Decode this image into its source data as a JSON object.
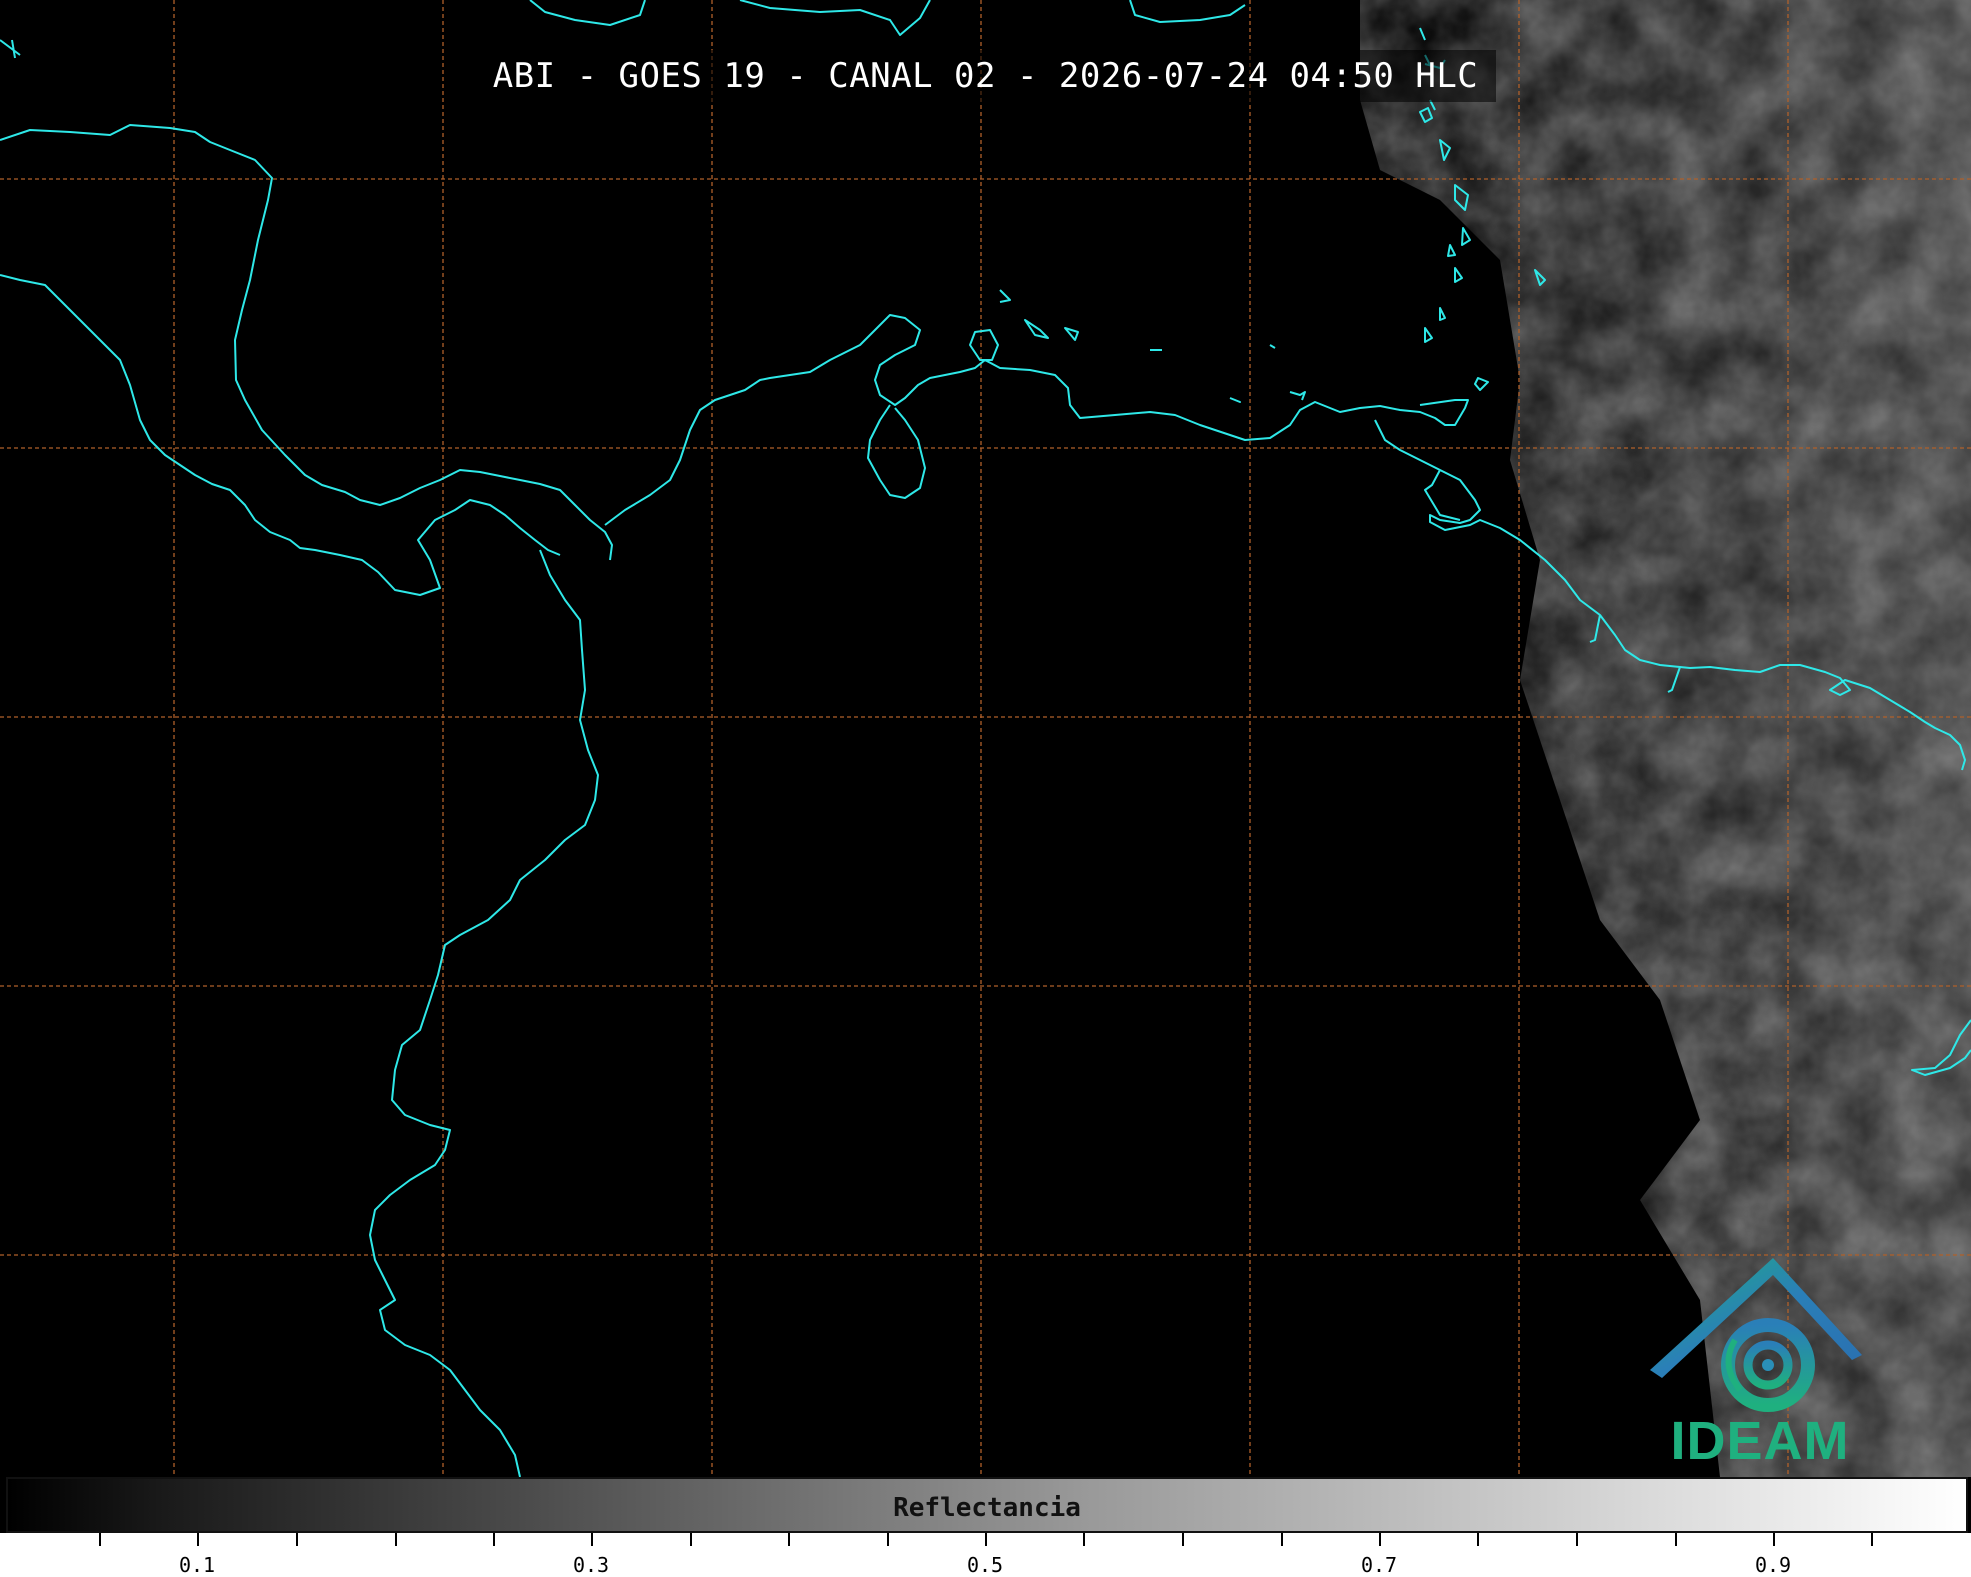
{
  "title": "ABI - GOES 19 - CANAL 02 - 2026-07-24 04:50 HLC",
  "colorbar": {
    "label": "Reflectancia",
    "ticks": [
      "0.1",
      "0.3",
      "0.5",
      "0.7",
      "0.9"
    ]
  },
  "logo": {
    "text": "IDEAM"
  },
  "colors": {
    "coastline": "#2ee8e8",
    "grid": "#b0602a",
    "logo_blue": "#2a6fb0",
    "logo_green": "#1fb07f"
  }
}
